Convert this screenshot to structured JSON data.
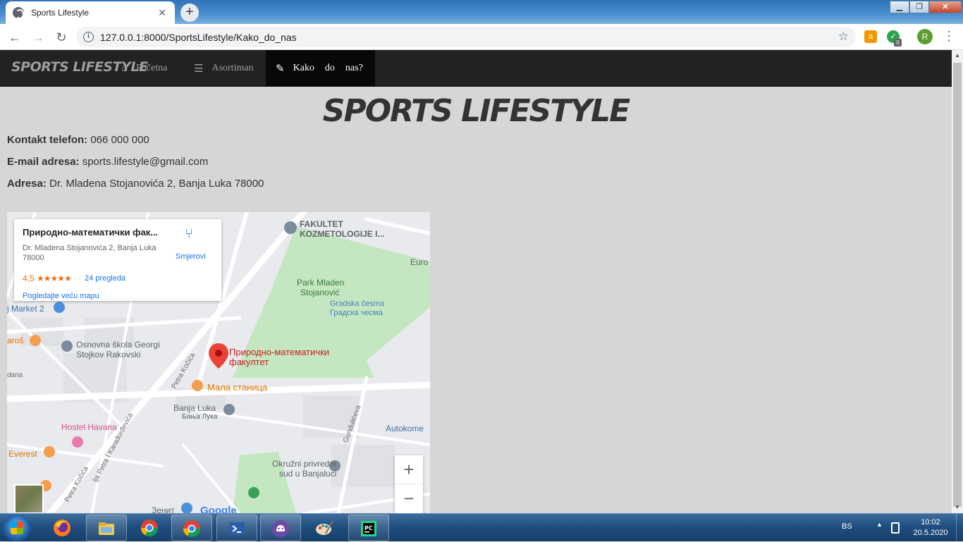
{
  "browser": {
    "tab_title": "Sports Lifestyle",
    "tab_close": "✕",
    "new_tab": "+",
    "url": "127.0.0.1:8000/SportsLifestyle/Kako_do_nas",
    "avatar_letter": "R",
    "ext_badge": "0"
  },
  "navbar": {
    "brand": "SPORTS LIFESTYLE",
    "items": [
      {
        "label": "Početna",
        "icon": "home-icon"
      },
      {
        "label": "Asortiman",
        "icon": "list-icon"
      },
      {
        "label_words": [
          "Kako",
          "do",
          "nas?"
        ],
        "icon": "pin-icon",
        "active": true
      }
    ]
  },
  "page": {
    "title": "SPORTS LIFESTYLE",
    "phone_label": "Kontakt telefon:",
    "phone_value": "066 000 000",
    "email_label": "E-mail adresa:",
    "email_value": "sports.lifestyle@gmail.com",
    "address_label": "Adresa:",
    "address_value": "Dr. Mladena Stojanovića 2, Banja Luka 78000"
  },
  "map": {
    "card": {
      "name": "Природно-математички фак...",
      "address": "Dr. Mladena Stojanovića 2, Banja Luka 78000",
      "rating": "4,5",
      "stars": "★★★★★",
      "reviews": "24 pregleda",
      "directions": "Smjerovi",
      "bigger_map": "Pogledajte veću mapu"
    },
    "labels": {
      "fakultet": "FAKULTET",
      "kozmetologije": "KOZMETOLOGIJE I...",
      "euro": "Euro",
      "park1": "Park Mladen",
      "park2": "Stojanović",
      "cesma1": "Gradska česma",
      "cesma2": "Градска чесма",
      "market": "j Market 2",
      "pmf1": "Природно-математички",
      "pmf2": "факултет",
      "skola1": "Osnovna škola Georgi",
      "skola2": "Stojkov Rakovski",
      "aros": "aroš",
      "dana": "dana",
      "petra_kocica": "Petra Kočića",
      "mala_stanica": "Мала станица",
      "banja_luka": "Banja Luka",
      "banja_luka_cyr": "Бања Лука",
      "gunduliceva": "Gundulićeva",
      "autokome": "Autokome",
      "hostel": "Hostel Havana",
      "everest": "Everest",
      "okruzni1": "Okružni privredni",
      "okruzni2": "sud u Banjaluci",
      "karadjordjevica": "lja Petra I Karađorđevića",
      "petra_kocica2": "Petra Kočića",
      "zenit": "Зенит",
      "google": "Google"
    },
    "zoom_in": "+",
    "zoom_out": "−"
  },
  "taskbar": {
    "lang": "BS",
    "time": "10:02",
    "date": "20.5.2020",
    "apps": [
      "firefox-icon",
      "explorer-icon",
      "chrome-icon",
      "chrome-icon",
      "powershell-icon",
      "github-icon",
      "paint-icon",
      "pycharm-icon"
    ]
  }
}
